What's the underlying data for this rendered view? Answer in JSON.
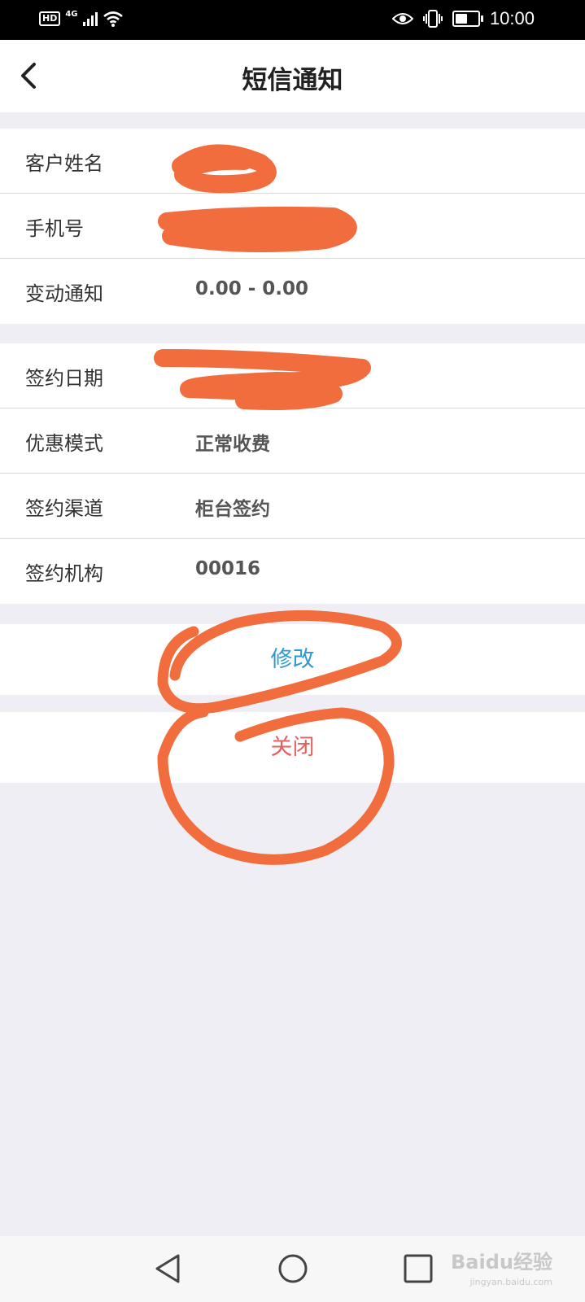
{
  "status_bar": {
    "hd": "HD",
    "network": "4G",
    "time": "10:00",
    "battery_level_pct": 55
  },
  "nav": {
    "title": "短信通知"
  },
  "info_group_1": [
    {
      "label": "客户姓名",
      "value": ""
    },
    {
      "label": "手机号",
      "value": ""
    },
    {
      "label": "变动通知",
      "value": "0.00 - 0.00"
    }
  ],
  "info_group_2": [
    {
      "label": "签约日期",
      "value": ""
    },
    {
      "label": "优惠模式",
      "value": "正常收费"
    },
    {
      "label": "签约渠道",
      "value": "柜台签约"
    },
    {
      "label": "签约机构",
      "value": "00016"
    }
  ],
  "buttons": {
    "modify": "修改",
    "close": "关闭"
  },
  "colors": {
    "modify": "#2b9ad6",
    "close": "#e0615d",
    "annotation": "#f26d3d",
    "background": "#efeef4"
  },
  "watermark": {
    "text": "Baidu经验",
    "sub": "jingyan.baidu.com"
  }
}
